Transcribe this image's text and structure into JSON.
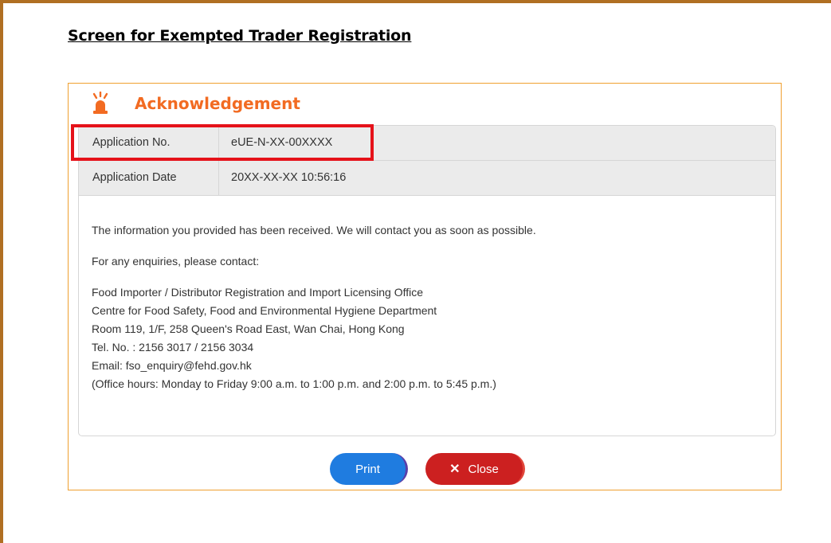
{
  "page": {
    "heading": "Screen for Exempted Trader Registration"
  },
  "dialog": {
    "title": "Acknowledgement",
    "icon": "alarm-light-icon",
    "accent_color": "#f26b22",
    "border_color": "#f0a030"
  },
  "application": {
    "number_label": "Application No.",
    "number_value": "eUE-N-XX-00XXXX",
    "date_label": "Application Date",
    "date_value": "20XX-XX-XX 10:56:16"
  },
  "message": {
    "received": "The information you provided has been received. We will contact you as soon as possible.",
    "enquiry": "For any enquiries, please contact:",
    "contact_lines": [
      "Food Importer / Distributor Registration and Import Licensing Office",
      "Centre for Food Safety, Food and Environmental Hygiene Department",
      "Room 119, 1/F, 258 Queen's Road East, Wan Chai, Hong Kong",
      "Tel. No. : 2156 3017 / 2156 3034",
      "Email: fso_enquiry@fehd.gov.hk",
      "(Office hours: Monday to Friday 9:00 a.m. to 1:00 p.m. and 2:00 p.m. to 5:45 p.m.)"
    ]
  },
  "buttons": {
    "print_label": "Print",
    "close_label": "Close",
    "print_color": "#1f7ce0",
    "close_color": "#cc2020"
  },
  "annotation": {
    "highlight_color": "#e5121a"
  }
}
